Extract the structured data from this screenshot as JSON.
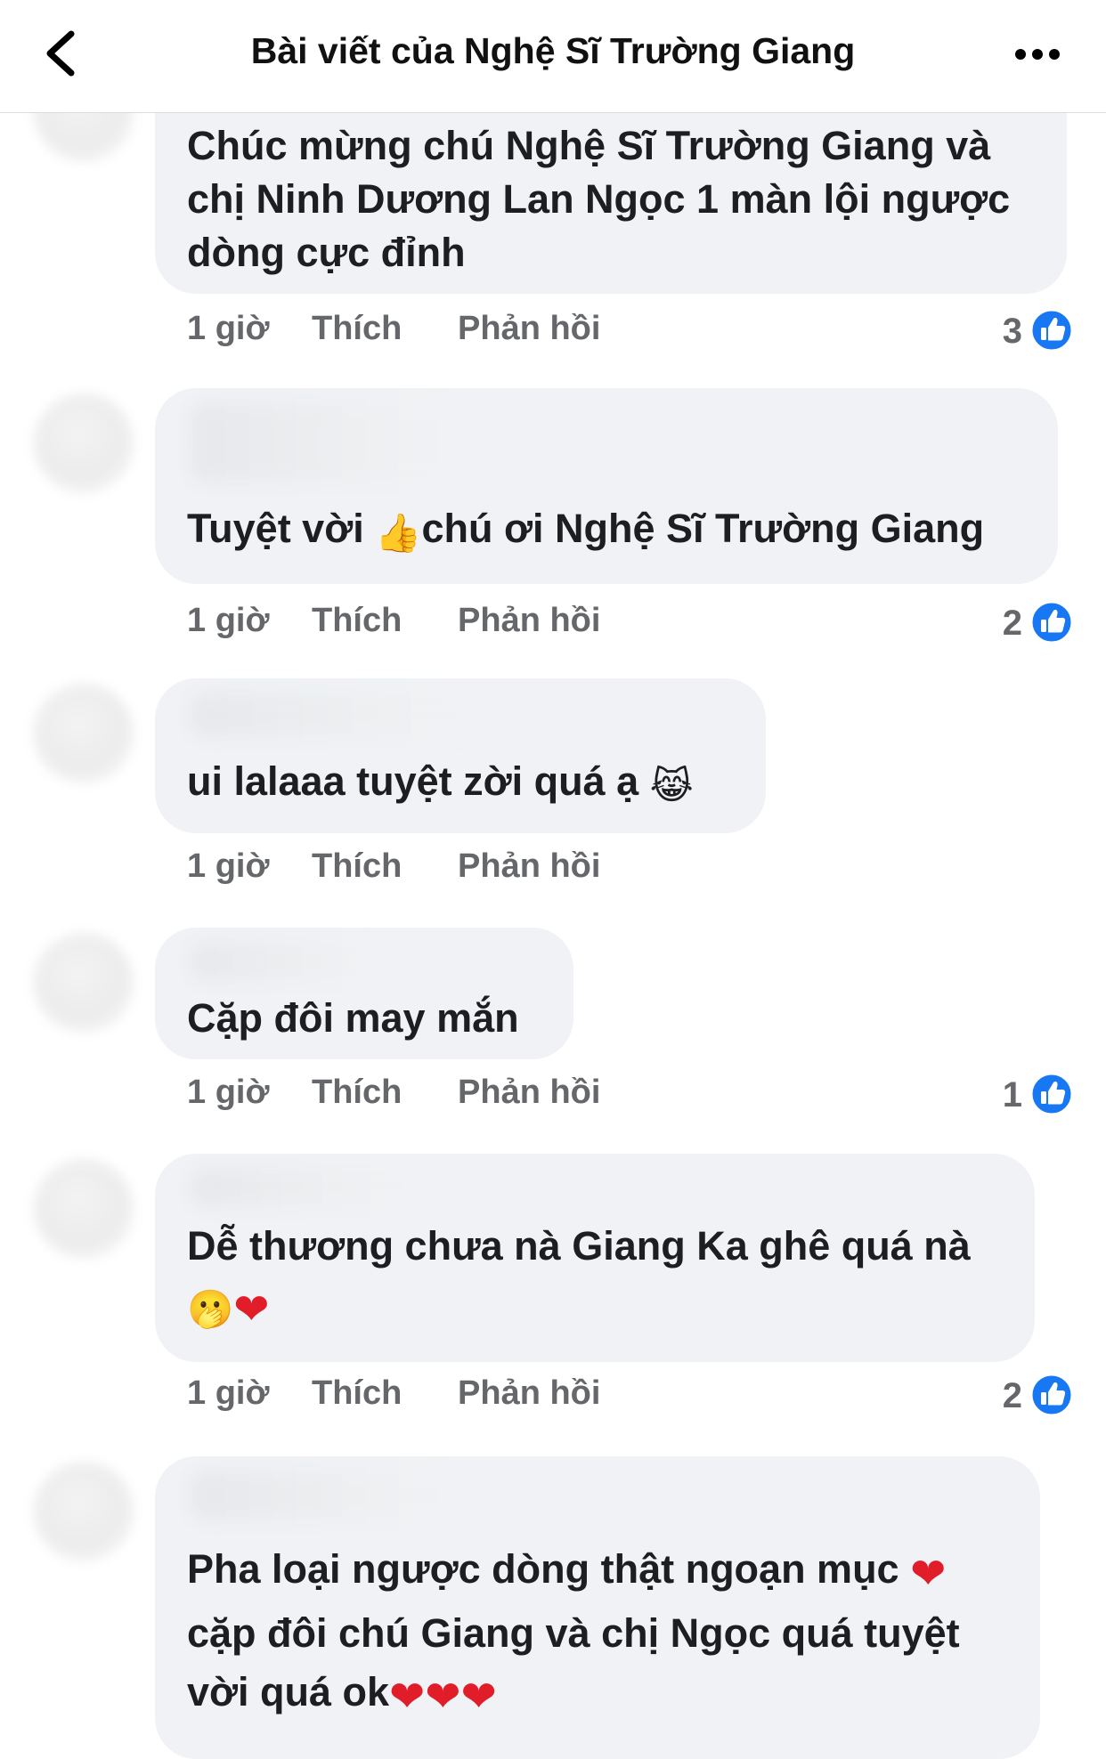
{
  "header": {
    "title": "Bài viết của Nghệ Sĩ Trường Giang"
  },
  "labels": {
    "like": "Thích",
    "reply": "Phản hồi"
  },
  "comments": [
    {
      "author": "",
      "lines": [
        "Chúc mừng chú Nghệ Sĩ Trường Giang và",
        "chị Ninh Dương Lan Ngọc 1 màn lội ngược",
        "dòng cực đỉnh"
      ],
      "time": "1 giờ",
      "reactions": "3"
    },
    {
      "author": "",
      "text_before": "Tuyệt vời ",
      "emoji": "👍",
      "text_after": "chú ơi Nghệ Sĩ Trường Giang",
      "time": "1 giờ",
      "reactions": "2"
    },
    {
      "author": "",
      "text": "ui lalaaa tuyệt zời quá ạ ",
      "emoji": "😹",
      "time": "1 giờ",
      "reactions": ""
    },
    {
      "author": "",
      "text": "Cặp đôi may mắn",
      "time": "1 giờ",
      "reactions": "1"
    },
    {
      "author": "",
      "line1": "Dễ thương chưa nà Giang Ka ghê quá nà",
      "emoji1": "🫢",
      "emoji2": "❤",
      "time": "1 giờ",
      "reactions": "2"
    },
    {
      "author": "",
      "line1": "Pha loại ngược dòng thật ngoạn mục ",
      "heart": "❤",
      "line2": "cặp đôi chú Giang và chị Ngọc quá tuyệt",
      "line3": "vời quá ok",
      "hearts": "❤❤❤"
    }
  ],
  "colors": {
    "bubble": "#f0f2f5",
    "meta_text": "#65676b",
    "like_blue": "#1877f2",
    "heart_red": "#e11d2a"
  },
  "icons": {
    "back": "chevron-left-icon",
    "more": "more-horizontal-icon",
    "like": "thumbs-up-icon"
  }
}
